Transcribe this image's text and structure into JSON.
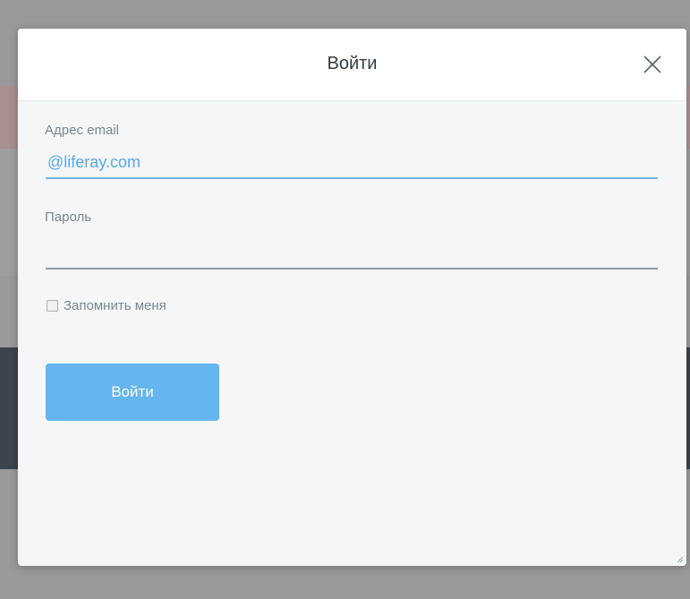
{
  "modal": {
    "title": "Войти",
    "close_icon": "close-icon"
  },
  "form": {
    "email_label": "Адрес email",
    "email_value": "@liferay.com",
    "password_label": "Пароль",
    "password_value": "",
    "remember_label": "Запомнить меня",
    "remember_checked": false,
    "submit_label": "Войти"
  },
  "colors": {
    "accent": "#65b5ee",
    "email_text": "#5aa8e6",
    "label": "#7c8791",
    "overlay": "#9a9a9a"
  }
}
